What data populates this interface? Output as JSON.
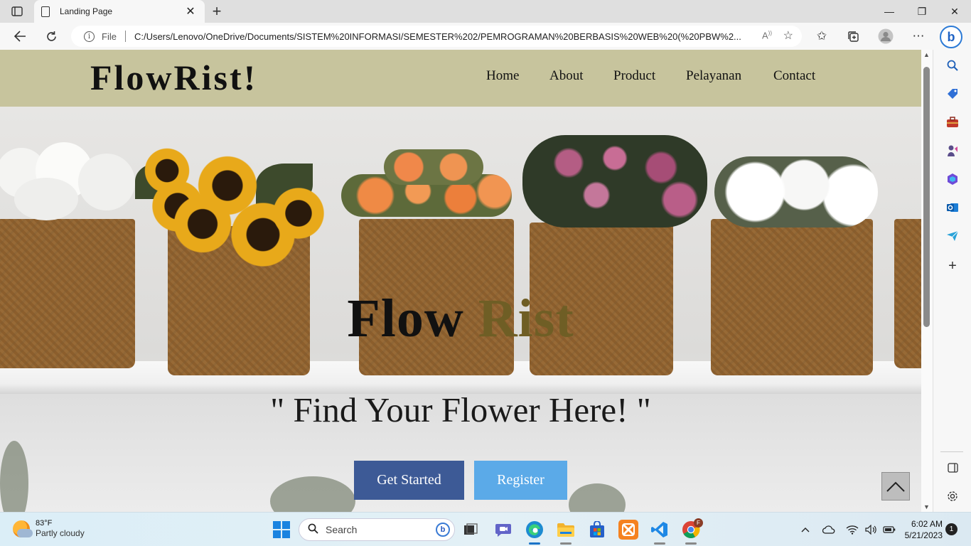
{
  "browser": {
    "tab_title": "Landing Page",
    "tab_close": "✕",
    "new_tab": "+",
    "address_file_label": "File",
    "address_url": "C:/Users/Lenovo/OneDrive/Documents/SISTEM%20INFORMASI/SEMESTER%202/PEMROGRAMAN%20BERBASIS%20WEB%20(%20PBW%2...",
    "read_aloud": "Aⁱ",
    "minimize": "—",
    "maximize": "❐",
    "close": "✕",
    "bing_label": "b"
  },
  "site": {
    "logo": "FlowRist!",
    "nav": [
      "Home",
      "About",
      "Product",
      "Pelayanan",
      "Contact"
    ],
    "hero_title_main": "Flow ",
    "hero_title_accent": "Rist",
    "tagline": "\" Find Your Flower Here! \"",
    "btn_get_started": "Get Started",
    "btn_register": "Register",
    "colors": {
      "navbar": "#c7c49d",
      "accent_text": "#6f5e25",
      "btn_primary": "#3d5a96",
      "btn_secondary": "#5baae8"
    }
  },
  "taskbar": {
    "weather_temp": "83°F",
    "weather_cond": "Partly cloudy",
    "search_placeholder": "Search",
    "time": "6:02 AM",
    "date": "5/21/2023",
    "notification_count": "1",
    "chrome_badge": "F"
  }
}
